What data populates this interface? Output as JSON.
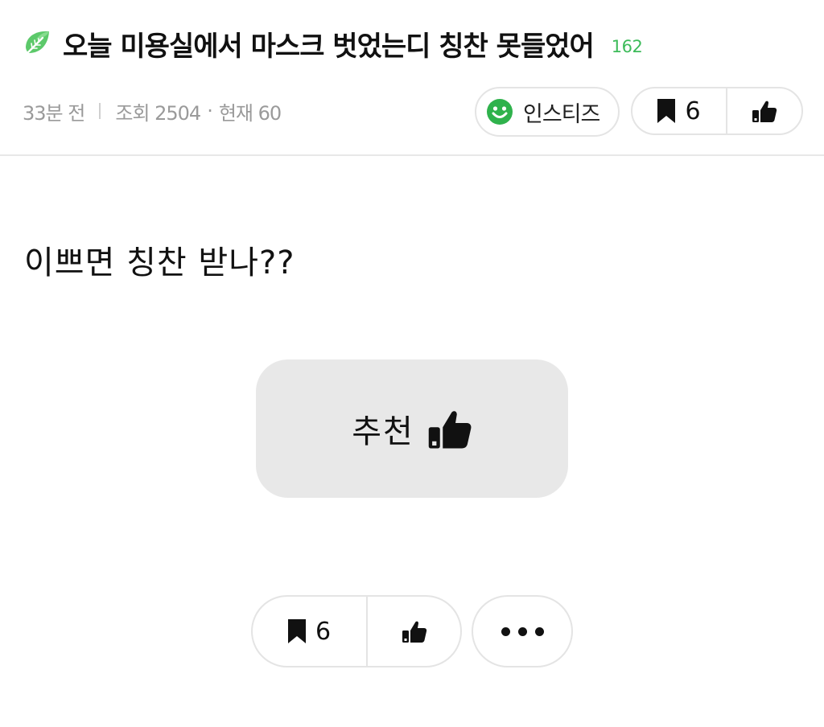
{
  "post": {
    "title": "오늘 미용실에서 마스크 벗었는디 칭찬 못들었어",
    "comment_count": "162",
    "time_ago": "33분 전",
    "views": "조회 2504",
    "dot": "·",
    "current": "현재 60",
    "body": "이쁘면 칭찬 받나??"
  },
  "board": {
    "name": "인스티즈",
    "icon": "smile-icon",
    "color": "#2fb24c"
  },
  "actions": {
    "scrap_count": "6",
    "recommend_label": "추천",
    "scrap_icon": "bookmark-icon",
    "like_icon": "thumbs-up-icon",
    "more_icon": "more-dots-icon"
  },
  "colors": {
    "accent_green": "#3dbb5a",
    "leaf_green": "#4cc25e",
    "button_bg": "#e8e8e8",
    "meta_gray": "#9a9a9a"
  }
}
